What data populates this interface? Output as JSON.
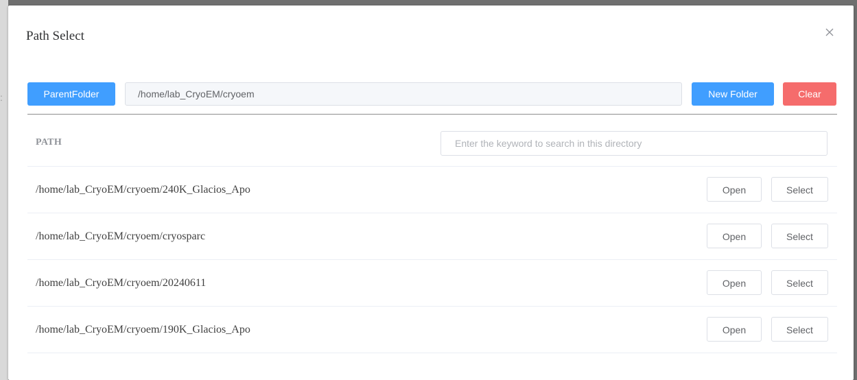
{
  "dialog": {
    "title": "Path Select"
  },
  "toolbar": {
    "parent_folder_label": "ParentFolder",
    "current_path": "/home/lab_CryoEM/cryoem",
    "new_folder_label": "New Folder",
    "clear_label": "Clear"
  },
  "table": {
    "column_header": "PATH",
    "search_placeholder": "Enter the keyword to search in this directory",
    "rows": [
      {
        "path": "/home/lab_CryoEM/cryoem/240K_Glacios_Apo",
        "open_label": "Open",
        "select_label": "Select"
      },
      {
        "path": "/home/lab_CryoEM/cryoem/cryosparc",
        "open_label": "Open",
        "select_label": "Select"
      },
      {
        "path": "/home/lab_CryoEM/cryoem/20240611",
        "open_label": "Open",
        "select_label": "Select"
      },
      {
        "path": "/home/lab_CryoEM/cryoem/190K_Glacios_Apo",
        "open_label": "Open",
        "select_label": "Select"
      }
    ]
  },
  "icons": {
    "close": "close-icon"
  },
  "colors": {
    "primary": "#409eff",
    "danger": "#f56c6c",
    "overlay": "#6f6f6f"
  }
}
